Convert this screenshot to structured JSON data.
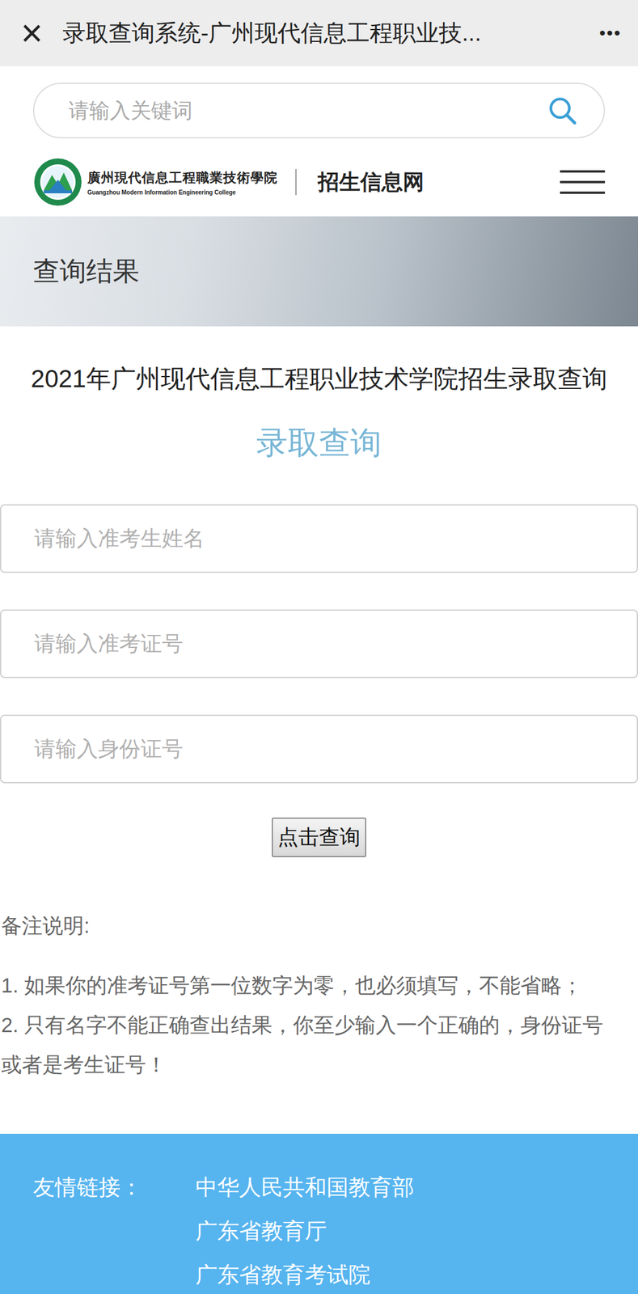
{
  "window": {
    "close": "×",
    "title": "录取查询系统-广州现代信息工程职业技...",
    "more": "•••"
  },
  "search": {
    "placeholder": "请输入关键词"
  },
  "header": {
    "school_name": "廣州現代信息工程職業技術學院",
    "school_name_en": "Guangzhou Modern Information Engineering College",
    "site": "招生信息网"
  },
  "banner": {
    "title": "查询结果"
  },
  "page_title": "2021年广州现代信息工程职业技术学院招生录取查询",
  "form": {
    "heading": "录取查询",
    "fields": [
      {
        "placeholder": "请输入准考生姓名"
      },
      {
        "placeholder": "请输入准考证号"
      },
      {
        "placeholder": "请输入身份证号"
      }
    ],
    "submit": "点击查询"
  },
  "notes": {
    "title": "备注说明:",
    "items": [
      "1. 如果你的准考证号第一位数字为零，也必须填写，不能省略；",
      "2. 只有名字不能正确查出结果，你至少输入一个正确的，身份证号或者是考生证号！"
    ]
  },
  "footer": {
    "label": "友情链接：",
    "links": [
      "中华人民共和国教育部",
      "广东省教育厅",
      "广东省教育考试院"
    ]
  }
}
